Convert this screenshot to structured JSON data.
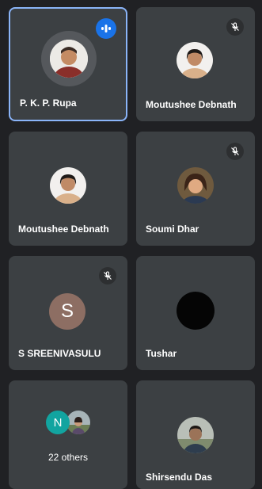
{
  "participants": [
    {
      "name": "P. K. P. Rupa",
      "status": "speaking",
      "speaking_icon": "audio-wave-icon"
    },
    {
      "name": "Moutushee Debnath",
      "status": "muted",
      "mute_icon": "mic-off-icon"
    },
    {
      "name": "Moutushee Debnath",
      "status": "unmuted"
    },
    {
      "name": "Soumi Dhar",
      "status": "muted",
      "mute_icon": "mic-off-icon"
    },
    {
      "name": "S SREENIVASULU",
      "status": "muted",
      "initial": "S",
      "mute_icon": "mic-off-icon"
    },
    {
      "name": "Tushar",
      "status": "unmuted"
    },
    {
      "name": "Shirsendu Das",
      "status": "unmuted"
    }
  ],
  "others": {
    "label": "22 others",
    "initial": "N"
  },
  "colors": {
    "background": "#202124",
    "tile": "#3c4043",
    "active_border": "#8ab4f8",
    "speaking_badge": "#1a73e8",
    "initial_s_bg": "#8d6e63",
    "initial_n_bg": "#12a4a0"
  }
}
